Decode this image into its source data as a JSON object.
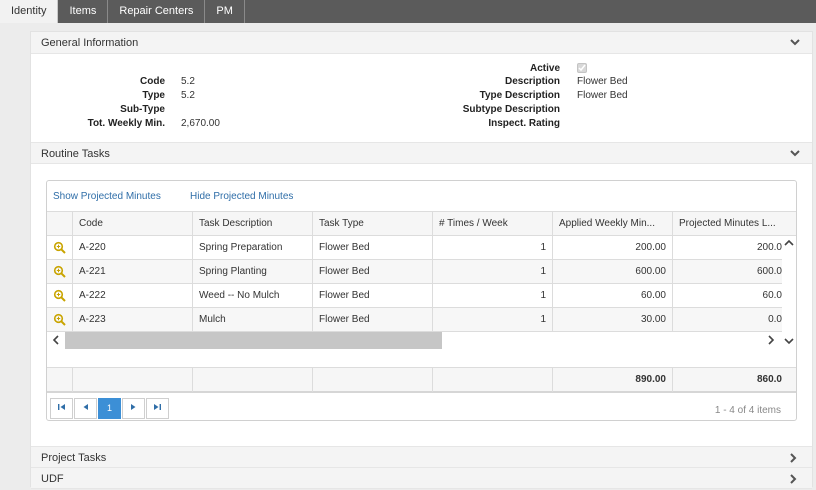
{
  "tabs": [
    "Identity",
    "Items",
    "Repair Centers",
    "PM"
  ],
  "general": {
    "title": "General Information",
    "left_fields": [
      {
        "label": "Code",
        "value": "5.2"
      },
      {
        "label": "Type",
        "value": "5.2"
      },
      {
        "label": "Sub-Type",
        "value": ""
      },
      {
        "label": "Tot. Weekly Min.",
        "value": "2,670.00"
      }
    ],
    "active_label": "Active",
    "active_checked": true,
    "right_fields": [
      {
        "label": "Description",
        "value": "Flower Bed"
      },
      {
        "label": "Type Description",
        "value": "Flower Bed"
      },
      {
        "label": "Subtype Description",
        "value": ""
      },
      {
        "label": "Inspect. Rating",
        "value": ""
      }
    ]
  },
  "routine": {
    "title": "Routine Tasks",
    "show_projected_label": "Show Projected Minutes",
    "hide_projected_label": "Hide Projected Minutes",
    "columns": [
      "Code",
      "Task Description",
      "Task Type",
      "# Times / Week",
      "Applied Weekly Min...",
      "Projected Minutes L..."
    ],
    "rows": [
      {
        "code": "A-220",
        "desc": "Spring Preparation",
        "type": "Flower Bed",
        "times": "1",
        "applied": "200.00",
        "projected": "200.0"
      },
      {
        "code": "A-221",
        "desc": "Spring Planting",
        "type": "Flower Bed",
        "times": "1",
        "applied": "600.00",
        "projected": "600.0"
      },
      {
        "code": "A-222",
        "desc": "Weed -- No Mulch",
        "type": "Flower Bed",
        "times": "1",
        "applied": "60.00",
        "projected": "60.0"
      },
      {
        "code": "A-223",
        "desc": "Mulch",
        "type": "Flower Bed",
        "times": "1",
        "applied": "30.00",
        "projected": "0.0"
      }
    ],
    "totals": {
      "applied": "890.00",
      "projected": "860.0"
    },
    "pager": {
      "current_page": "1",
      "info": "1 - 4 of 4 items"
    }
  },
  "project_tasks_title": "Project Tasks",
  "udf_title": "UDF"
}
